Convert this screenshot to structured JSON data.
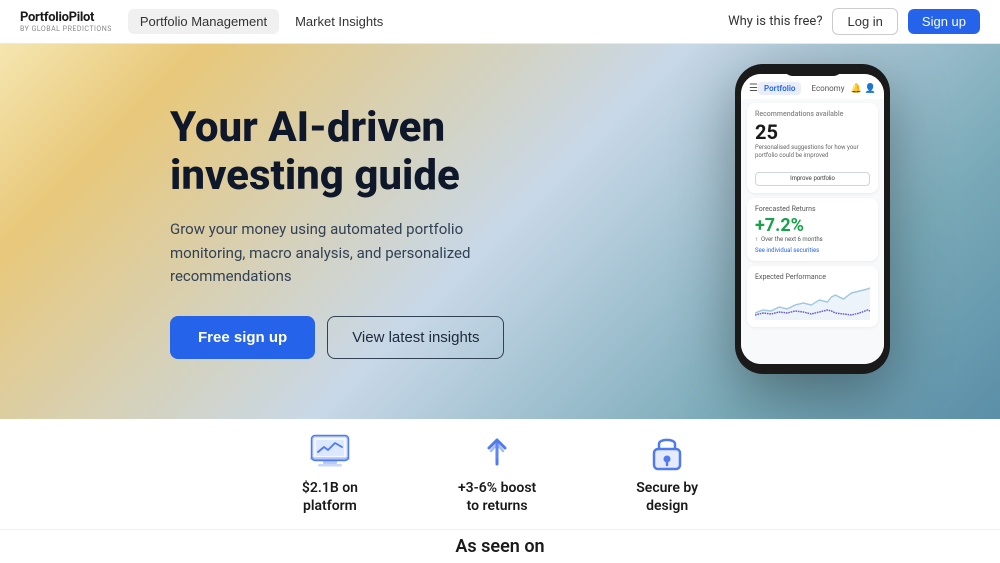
{
  "navbar": {
    "logo_name": "PortfolioPilot",
    "logo_sub": "BY GLOBAL PREDICTIONS",
    "nav_items": [
      {
        "label": "Portfolio Management",
        "active": true
      },
      {
        "label": "Market Insights",
        "active": false
      }
    ],
    "why_label": "Why is this free?",
    "login_label": "Log in",
    "signup_label": "Sign up"
  },
  "hero": {
    "title_line1": "Your AI-driven",
    "title_line2": "investing guide",
    "description": "Grow your money using automated portfolio monitoring, macro analysis, and personalized recommendations",
    "btn_primary": "Free sign up",
    "btn_secondary": "View latest insights"
  },
  "phone": {
    "tab_portfolio": "Portfolio",
    "tab_economy": "Economy",
    "recommendations_label": "Recommendations available",
    "recommendations_count": "25",
    "recommendations_desc": "Personalised suggestions for how your portfolio could be improved",
    "improve_btn": "Improve portfolio",
    "forecasted_title": "Forecasted Returns",
    "forecasted_value": "+7.2%",
    "forecasted_period": "Over the next 6 months",
    "see_securities_link": "See individual securities",
    "performance_title": "Expected Performance"
  },
  "stats": [
    {
      "id": "platform",
      "icon": "monitor-icon",
      "text_line1": "$2.1B on",
      "text_line2": "platform"
    },
    {
      "id": "boost",
      "icon": "arrow-up-icon",
      "text_line1": "+3-6% boost",
      "text_line2": "to returns"
    },
    {
      "id": "secure",
      "icon": "lock-icon",
      "text_line1": "Secure by",
      "text_line2": "design"
    }
  ],
  "as_seen_on": {
    "title": "As seen on"
  }
}
